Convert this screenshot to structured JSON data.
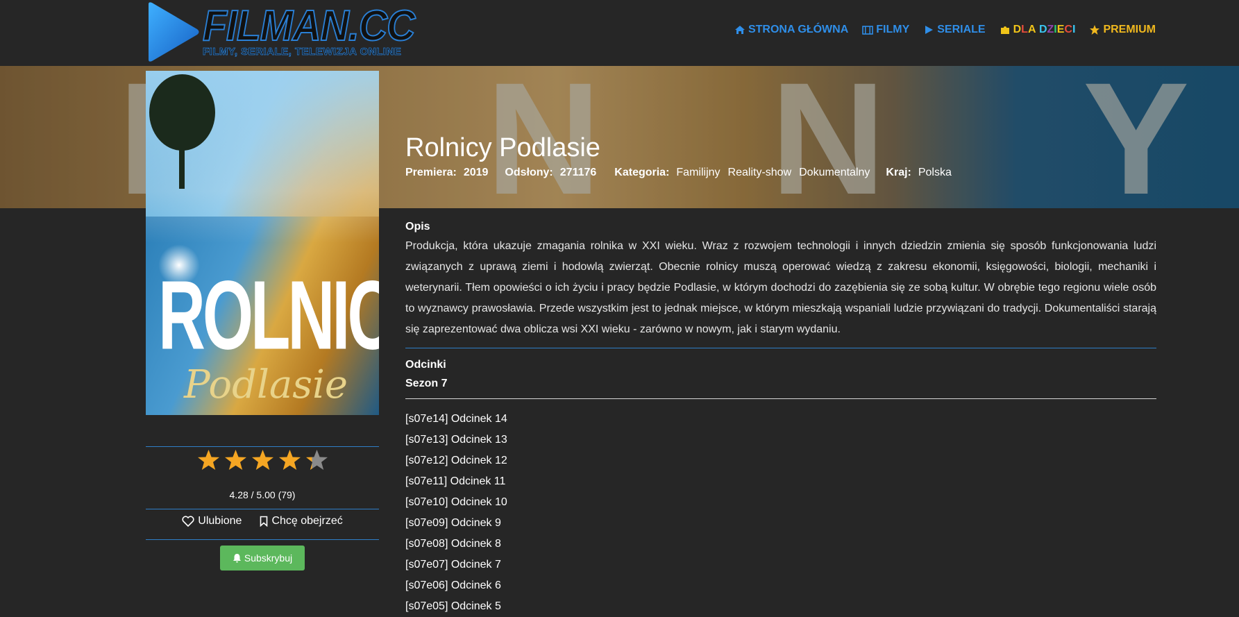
{
  "site": {
    "logo_title": "FILMAN.CC",
    "logo_subtitle": "FILMY, SERIALE, TELEWIZJA ONLINE",
    "accent": "#2f8ee8"
  },
  "nav": {
    "home": "STRONA GŁÓWNA",
    "movies": "FILMY",
    "series": "SERIALE",
    "kids_letters": [
      "D",
      "L",
      "A",
      " ",
      "D",
      "Z",
      "I",
      "E",
      "C",
      "I"
    ],
    "premium": "PREMIUM"
  },
  "banner": {
    "letters": [
      "I",
      "N",
      "N",
      "Y"
    ]
  },
  "show": {
    "title": "Rolnicy Podlasie",
    "premiere_label": "Premiera:",
    "premiere": "2019",
    "views_label": "Odsłony:",
    "views": "271176",
    "category_label": "Kategoria:",
    "categories": [
      "Familijny",
      "Reality-show",
      "Dokumentalny"
    ],
    "country_label": "Kraj:",
    "country": "Polska"
  },
  "poster": {
    "title": "ROLNICY",
    "subtitle": "Podlasie"
  },
  "rating": {
    "stars_value": 4.28,
    "text": "4.28 / 5.00 (79)",
    "favorite_label": "Ulubione",
    "watchlist_label": "Chcę obejrzeć",
    "subscribe_label": "Subskrybuj",
    "star_color": "#f5a623",
    "star_empty_color": "#8a8a8a"
  },
  "description": {
    "heading": "Opis",
    "text": "Produkcja, która ukazuje zmagania rolnika w XXI wieku. Wraz z rozwojem technologii i innych dziedzin zmienia się sposób funkcjonowania ludzi związanych z uprawą ziemi i hodowlą zwierząt. Obecnie rolnicy muszą operować wiedzą z zakresu ekonomii, księgowości, biologii, mechaniki i weterynarii. Tłem opowieści o ich życiu i pracy będzie Podlasie, w którym dochodzi do zazębienia się ze sobą kultur. W obrębie tego regionu wiele osób to wyznawcy prawosławia. Przede wszystkim jest to jednak miejsce, w którym mieszkają wspaniali ludzie przywiązani do tradycji. Dokumentaliści starają się zaprezentować dwa oblicza wsi XXI wieku - zarówno w nowym, jak i starym wydaniu."
  },
  "episodes": {
    "heading": "Odcinki",
    "season": "Sezon 7",
    "items": [
      "[s07e14] Odcinek 14",
      "[s07e13] Odcinek 13",
      "[s07e12] Odcinek 12",
      "[s07e11] Odcinek 11",
      "[s07e10] Odcinek 10",
      "[s07e09] Odcinek 9",
      "[s07e08] Odcinek 8",
      "[s07e07] Odcinek 7",
      "[s07e06] Odcinek 6",
      "[s07e05] Odcinek 5"
    ]
  }
}
